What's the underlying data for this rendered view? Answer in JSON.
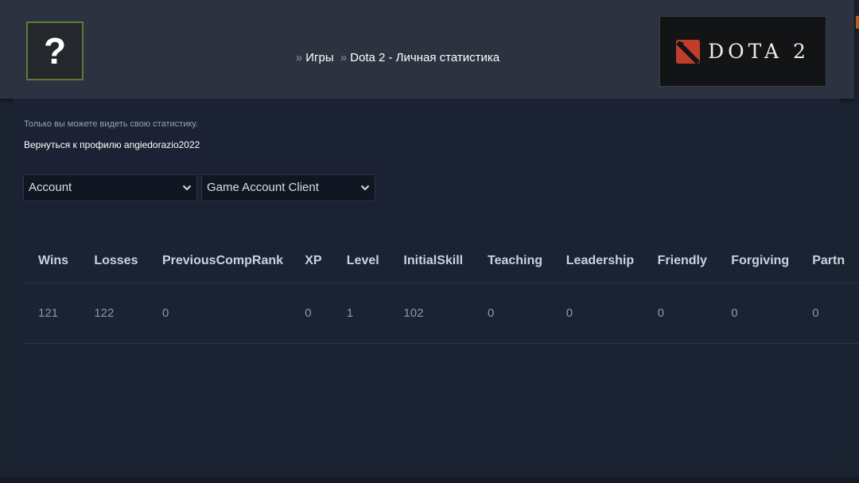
{
  "header": {
    "avatar_glyph": "?",
    "breadcrumb": [
      {
        "label": "Игры"
      },
      {
        "label": "Dota 2 - Личная статистика"
      }
    ],
    "breadcrumb_separator": "»",
    "game_logo_text": "DOTA 2"
  },
  "notice": {
    "private_text": "Только вы можете видеть свою статистику.",
    "back_link": "Вернуться к профилю angiedorazio2022"
  },
  "filters": {
    "category": {
      "selected": "Account"
    },
    "source": {
      "selected": "Game Account Client"
    }
  },
  "stats_table": {
    "columns": [
      "Wins",
      "Losses",
      "PreviousCompRank",
      "XP",
      "Level",
      "InitialSkill",
      "Teaching",
      "Leadership",
      "Friendly",
      "Forgiving",
      "Partn"
    ],
    "rows": [
      [
        "121",
        "122",
        "0",
        "0",
        "1",
        "102",
        "0",
        "0",
        "0",
        "0",
        "0"
      ]
    ]
  },
  "colors": {
    "background": "#1b2330",
    "header": "#2c3240",
    "logo_red": "#c23c2a"
  }
}
